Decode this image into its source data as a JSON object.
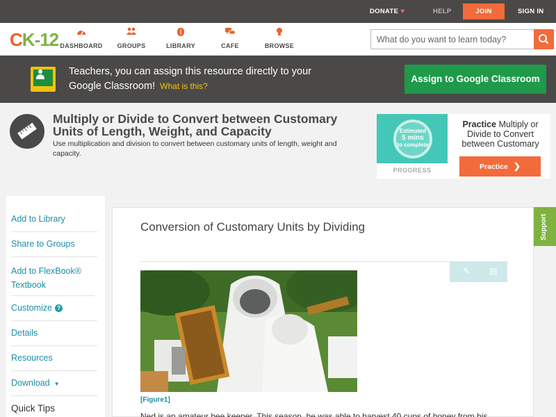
{
  "topbar": {
    "donate": "DONATE",
    "help": "HELP",
    "join": "JOIN",
    "signin": "SIGN IN"
  },
  "logo": {
    "c": "C",
    "k": "K",
    "num": "-12"
  },
  "nav": {
    "dashboard": "DASHBOARD",
    "groups": "GROUPS",
    "library": "LIBRARY",
    "cafe": "CAFE",
    "browse": "BROWSE"
  },
  "search": {
    "placeholder": "What do you want to learn today?"
  },
  "banner": {
    "text": "Teachers, you can assign this resource directly to your Google Classroom!",
    "what_is": "What is this?",
    "assign_button": "Assign to Google Classroom"
  },
  "concept": {
    "title": "Multiply or Divide to Convert between Customary Units of Length, Weight, and Capacity",
    "subtitle": "Use multiplication and division to convert between customary units of length, weight and capacity."
  },
  "practice": {
    "estimate_line1": "Estimated",
    "estimate_line2": "5 mins",
    "estimate_line3": "to complete",
    "progress_label": "PROGRESS",
    "heading_bold": "Practice",
    "heading_rest": "Multiply or Divide to Convert between Customary",
    "button": "Practice"
  },
  "sidemenu": {
    "items": [
      "Add to Library",
      "Share to Groups",
      "Add to FlexBook® Textbook",
      "Customize",
      "Details",
      "Resources",
      "Download"
    ],
    "quick_tips": "Quick Tips"
  },
  "content": {
    "heading": "Conversion of Customary Units by Dividing",
    "figure_caption": "[Figure1]",
    "paragraph": "Ned is an amateur bee keeper. This season, he was able to harvest 40 cups of honey from his"
  },
  "support_tab": "Support",
  "colors": {
    "brand_orange": "#f26b3a",
    "brand_green": "#7fb241",
    "link_teal": "#1a8fa6",
    "google_green": "#1e9a4a",
    "dark_bar": "#4a4948"
  }
}
